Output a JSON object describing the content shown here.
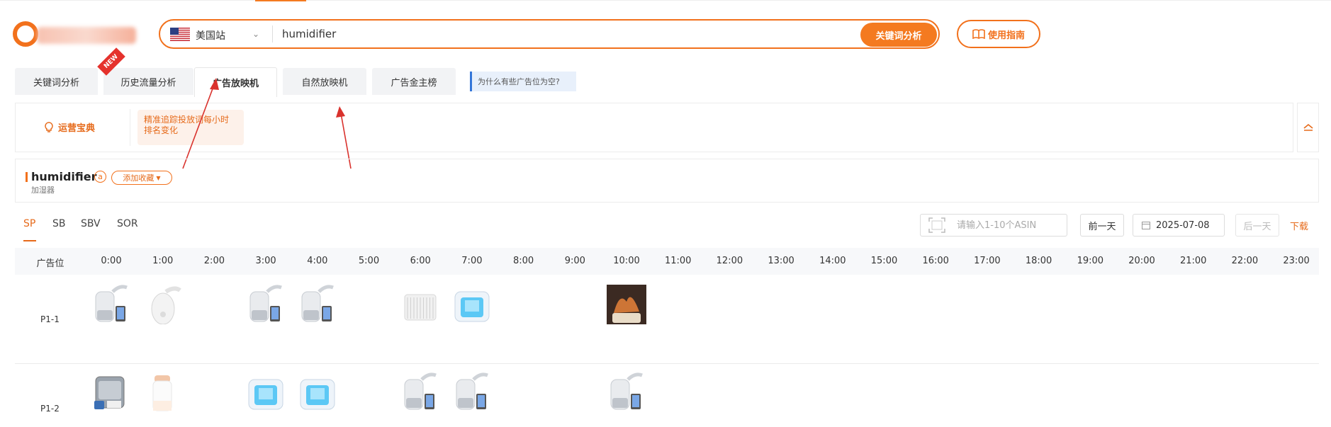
{
  "search": {
    "site": "美国站",
    "query": "humidifier",
    "button": "关键词分析"
  },
  "guide_button": "使用指南",
  "tabs": [
    {
      "label": "关键词分析"
    },
    {
      "label": "历史流量分析"
    },
    {
      "label": "广告放映机"
    },
    {
      "label": "自然放映机"
    },
    {
      "label": "广告金主榜"
    }
  ],
  "new_badge": "NEW",
  "tab_hint": "为什么有些广告位为空?",
  "info": {
    "label": "运营宝典",
    "tip_line1": "精准追踪投放词每小时",
    "tip_line2": "排名变化"
  },
  "keyword": {
    "title": "humidifier",
    "icon": "a",
    "favorite": "添加收藏",
    "subtitle": "加湿器"
  },
  "ad_types": [
    "SP",
    "SB",
    "SBV",
    "SOR"
  ],
  "controls": {
    "asin_placeholder": "请输入1-10个ASIN",
    "prev_day": "前一天",
    "date": "2025-07-08",
    "next_day": "后一天",
    "download": "下载"
  },
  "table": {
    "position_header": "广告位",
    "hours": [
      "0:00",
      "1:00",
      "2:00",
      "3:00",
      "4:00",
      "5:00",
      "6:00",
      "7:00",
      "8:00",
      "9:00",
      "10:00",
      "11:00",
      "12:00",
      "13:00",
      "14:00",
      "15:00",
      "16:00",
      "17:00",
      "18:00",
      "19:00",
      "20:00",
      "21:00",
      "22:00",
      "23:00"
    ],
    "rows": [
      {
        "label": "P1-1",
        "thumbs": [
          "gray-tower-humidifier",
          "white-round-humidifier",
          null,
          "gray-tower-humidifier",
          "gray-tower-humidifier",
          null,
          "white-ribbed-humidifier",
          "blue-cube-humidifier",
          null,
          null,
          "flame-diffuser"
        ]
      },
      {
        "label": "P1-2",
        "thumbs": [
          "gray-tank-humidifier",
          "peach-cylinder-humidifier",
          null,
          "blue-cube-humidifier",
          "blue-cube-humidifier",
          null,
          "gray-tower-humidifier",
          "gray-tower-humidifier",
          null,
          null,
          "gray-tower-humidifier"
        ]
      }
    ]
  },
  "colors": {
    "brand": "#f2711c",
    "accent_text": "#e66a1a",
    "hint_border": "#3476d9"
  }
}
